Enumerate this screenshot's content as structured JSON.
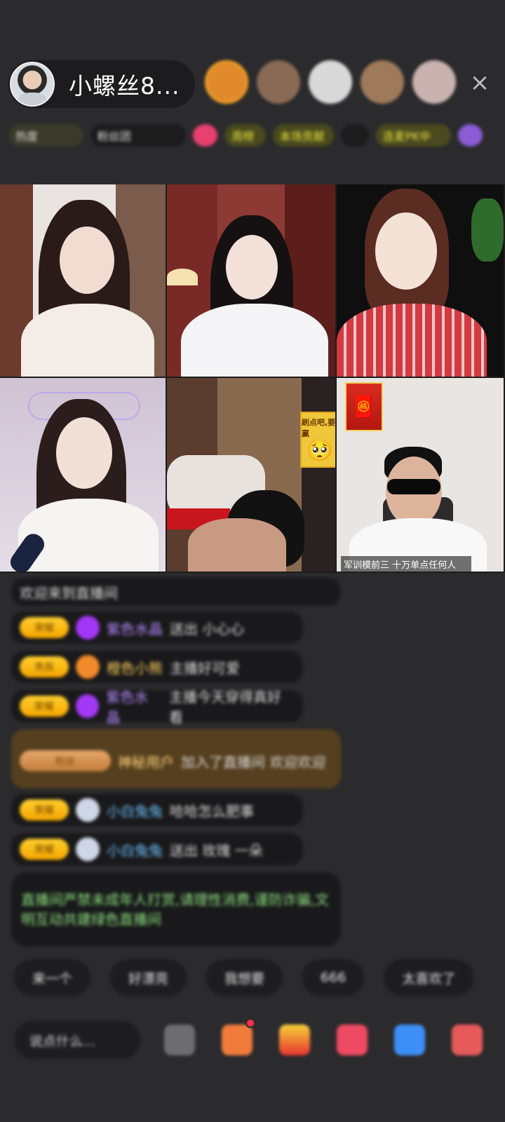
{
  "header": {
    "host_name": "小螺丝8...",
    "close_label": "×",
    "viewer_avatars": [
      {
        "name": "top-viewer-1",
        "color": "#e08a2c"
      },
      {
        "name": "top-viewer-2",
        "color": "#8a6a55"
      },
      {
        "name": "top-viewer-3",
        "color": "#d9d9d9"
      },
      {
        "name": "top-viewer-4",
        "color": "#9e7a5a"
      },
      {
        "name": "top-viewer-5",
        "color": "#c9b3b0"
      }
    ],
    "info_chips": [
      "热度",
      "粉丝团",
      "",
      "周榜",
      "本场贡献",
      "",
      "",
      "连麦PK中",
      ""
    ]
  },
  "video_grid": {
    "sticker_text": "刷点吧,要赢",
    "sticker_face": "🥺",
    "banner_icon": "🧧",
    "seat_label": "军训模前三    十万单点任何人",
    "cells": [
      {
        "bg": "#6d3a2e",
        "skin": "#f1dcd2",
        "hair": "#2a1a18",
        "cloth": "#f3ece7"
      },
      {
        "bg": "#7a2a26",
        "skin": "#f3e0d8",
        "hair": "#151112",
        "cloth": "#f4f4f6"
      },
      {
        "bg": "#0f0f0f",
        "skin": "#f5e2d7",
        "hair": "#5a2c22",
        "cloth": "#d23a42"
      },
      {
        "bg": "#cfc3d4",
        "skin": "#f2e0d7",
        "hair": "#2b1d1b",
        "cloth": "#f6f4f2"
      },
      {
        "bg": "#5a3d2e",
        "skin": "#c99a82",
        "hair": "#121212",
        "cloth": "#e8e2df"
      },
      {
        "bg": "#e9e5e3",
        "skin": "#dcb49b",
        "hair": "#111111",
        "cloth": "#f8f8f8"
      }
    ]
  },
  "chat": {
    "system": "欢迎来到直播间",
    "messages": [
      {
        "level": "荣耀",
        "user": "紫色水晶",
        "text": "送出 小心心",
        "gem": "#a238f5"
      },
      {
        "level": "贵族",
        "user": "橙色小熊",
        "text": "主播好可爱",
        "gem": "#f08a2a"
      },
      {
        "level": "荣耀",
        "user": "紫色水晶",
        "text": "主播今天穿得真好看",
        "gem": "#a238f5"
      },
      {
        "level": "粉丝",
        "user": "神秘用户",
        "text": "加入了直播间 欢迎欢迎",
        "gem": "#f5a500"
      },
      {
        "level": "荣耀",
        "user": "小白兔兔",
        "text": "哈哈怎么肥事",
        "gem": "#cfd6e6"
      },
      {
        "level": "荣耀",
        "user": "小白兔兔",
        "text": "送出 玫瑰 一朵",
        "gem": "#cfd6e6"
      }
    ],
    "notice": "直播间严禁未成年人打赏,请理性消费,谨防诈骗,文明互动共建绿色直播间"
  },
  "quick_replies": [
    "来一个",
    "好漂亮",
    "我想要",
    "666",
    "太喜欢了"
  ],
  "bottom_bar": {
    "say_placeholder": "说点什么...",
    "tools": [
      {
        "name": "share-icon",
        "color": "#6d6d6f"
      },
      {
        "name": "gift-box-icon",
        "color": "#f07b3b"
      },
      {
        "name": "treasure-icon",
        "color": "#f3b227"
      },
      {
        "name": "heart-icon",
        "color": "#ee4a63"
      },
      {
        "name": "chat-bubble-icon",
        "color": "#3d8ef5"
      },
      {
        "name": "more-icon",
        "color": "#e85a5a"
      }
    ]
  }
}
